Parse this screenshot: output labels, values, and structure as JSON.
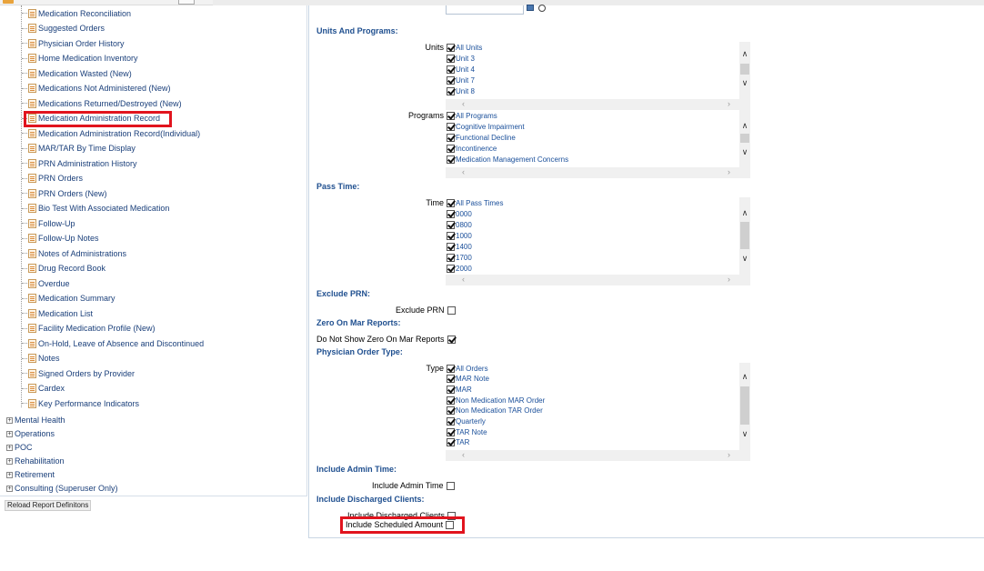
{
  "tree": {
    "items": [
      {
        "label": "Medication Reconciliation"
      },
      {
        "label": "Suggested Orders"
      },
      {
        "label": "Physician Order History"
      },
      {
        "label": "Home Medication Inventory"
      },
      {
        "label": "Medication Wasted (New)"
      },
      {
        "label": "Medications Not Administered (New)"
      },
      {
        "label": "Medications Returned/Destroyed (New)"
      },
      {
        "label": "Medication Administration Record"
      },
      {
        "label": "Medication Administration Record(Individual)"
      },
      {
        "label": "MAR/TAR By Time Display"
      },
      {
        "label": "PRN Administration History"
      },
      {
        "label": "PRN Orders"
      },
      {
        "label": "PRN Orders (New)"
      },
      {
        "label": "Bio Test With Associated Medication"
      },
      {
        "label": "Follow-Up"
      },
      {
        "label": "Follow-Up Notes"
      },
      {
        "label": "Notes of Administrations"
      },
      {
        "label": "Drug Record Book"
      },
      {
        "label": "Overdue"
      },
      {
        "label": "Medication Summary"
      },
      {
        "label": "Medication List"
      },
      {
        "label": "Facility Medication Profile (New)"
      },
      {
        "label": "On-Hold, Leave of Absence and Discontinued"
      },
      {
        "label": "Notes"
      },
      {
        "label": "Signed Orders by Provider"
      },
      {
        "label": "Cardex"
      },
      {
        "label": "Key Performance Indicators"
      }
    ],
    "groups": [
      {
        "label": "Mental Health"
      },
      {
        "label": "Operations"
      },
      {
        "label": "POC"
      },
      {
        "label": "Rehabilitation"
      },
      {
        "label": "Retirement"
      },
      {
        "label": "Consulting (Superuser Only)"
      }
    ],
    "reload_label": "Reload Report Definitons"
  },
  "panel": {
    "units_programs": {
      "title": "Units And Programs:",
      "units_label": "Units",
      "units": [
        {
          "label": "All Units",
          "checked": true
        },
        {
          "label": "Unit 3",
          "checked": true
        },
        {
          "label": "Unit 4",
          "checked": true
        },
        {
          "label": "Unit 7",
          "checked": true
        },
        {
          "label": "Unit 8",
          "checked": true
        }
      ],
      "programs_label": "Programs",
      "programs": [
        {
          "label": "All Programs",
          "checked": true
        },
        {
          "label": "Cognitive Impairment",
          "checked": true
        },
        {
          "label": "Functional Decline",
          "checked": true
        },
        {
          "label": "Incontinence",
          "checked": true
        },
        {
          "label": "Medication Management Concerns",
          "checked": true
        }
      ]
    },
    "pass_time": {
      "title": "Pass Time:",
      "time_label": "Time",
      "times": [
        {
          "label": "All Pass Times",
          "checked": true
        },
        {
          "label": "0000",
          "checked": true
        },
        {
          "label": "0800",
          "checked": true
        },
        {
          "label": "1000",
          "checked": true
        },
        {
          "label": "1400",
          "checked": true
        },
        {
          "label": "1700",
          "checked": true
        },
        {
          "label": "2000",
          "checked": true
        }
      ]
    },
    "exclude_prn": {
      "title": "Exclude PRN:",
      "label": "Exclude PRN",
      "checked": false
    },
    "zero_on_mar": {
      "title": "Zero On Mar Reports:",
      "label": "Do Not Show Zero On Mar Reports",
      "checked": true
    },
    "order_type": {
      "title": "Physician Order Type:",
      "type_label": "Type",
      "types": [
        {
          "label": "All Orders",
          "checked": true
        },
        {
          "label": "MAR Note",
          "checked": true
        },
        {
          "label": "MAR",
          "checked": true
        },
        {
          "label": "Non Medication MAR Order",
          "checked": true
        },
        {
          "label": "Non Medication TAR Order",
          "checked": true
        },
        {
          "label": "Quarterly",
          "checked": true
        },
        {
          "label": "TAR Note",
          "checked": true
        },
        {
          "label": "TAR",
          "checked": true
        }
      ]
    },
    "admin_time": {
      "title": "Include Admin Time:",
      "label": "Include Admin Time",
      "checked": false
    },
    "discharged": {
      "title": "Include Discharged Clients:",
      "label": "Include Discharged Clients",
      "checked": false
    },
    "scheduled": {
      "label": "Include Scheduled Amount",
      "checked": false
    }
  }
}
